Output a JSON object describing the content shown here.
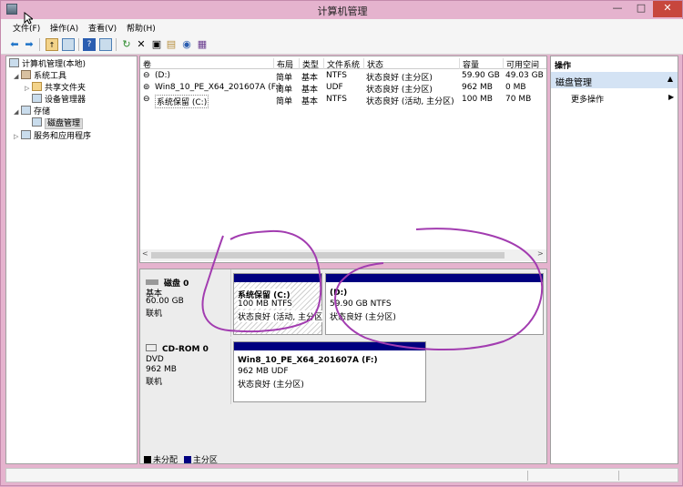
{
  "window": {
    "title": "计算机管理",
    "min_glyph": "—",
    "max_glyph": "□",
    "close_glyph": "✕"
  },
  "menu": [
    "文件(F)",
    "操作(A)",
    "查看(V)",
    "帮助(H)"
  ],
  "tree": {
    "root": "计算机管理(本地)",
    "system_tools": "系统工具",
    "shared_folders": "共享文件夹",
    "device_manager": "设备管理器",
    "storage": "存储",
    "disk_management": "磁盘管理",
    "services": "服务和应用程序"
  },
  "volumes": {
    "headers": [
      "卷",
      "布局",
      "类型",
      "文件系统",
      "状态",
      "容量",
      "可用空间"
    ],
    "rows": [
      [
        "(D:)",
        "简单",
        "基本",
        "NTFS",
        "状态良好 (主分区)",
        "59.90 GB",
        "49.03 GB"
      ],
      [
        "Win8_10_PE_X64_201607A (F:)",
        "简单",
        "基本",
        "UDF",
        "状态良好 (主分区)",
        "962 MB",
        "0 MB"
      ],
      [
        "系统保留 (C:)",
        "简单",
        "基本",
        "NTFS",
        "状态良好 (活动, 主分区)",
        "100 MB",
        "70 MB"
      ]
    ]
  },
  "disks": {
    "disk0": {
      "name": "磁盘 0",
      "type": "基本",
      "size": "60.00 GB",
      "state": "联机",
      "part_c": {
        "name": "系统保留  (C:)",
        "size": "100 MB NTFS",
        "status": "状态良好 (活动, 主分区"
      },
      "part_d": {
        "name": "(D:)",
        "size": "59.90 GB NTFS",
        "status": "状态良好 (主分区)"
      }
    },
    "cdrom0": {
      "name": "CD-ROM 0",
      "type": "DVD",
      "size": "962 MB",
      "state": "联机",
      "part_f": {
        "name": "Win8_10_PE_X64_201607A  (F:)",
        "size": "962 MB UDF",
        "status": "状态良好 (主分区)"
      }
    }
  },
  "legend": {
    "unallocated": "未分配",
    "primary": "主分区"
  },
  "actions": {
    "header": "操作",
    "section": "磁盘管理",
    "more": "更多操作"
  },
  "colors": {
    "primary_partition": "#000080",
    "unallocated": "#000000",
    "annotation_ink": "#a23cb0",
    "action_section": "#d4e3f4",
    "titlebar": "#e5b3ce"
  }
}
